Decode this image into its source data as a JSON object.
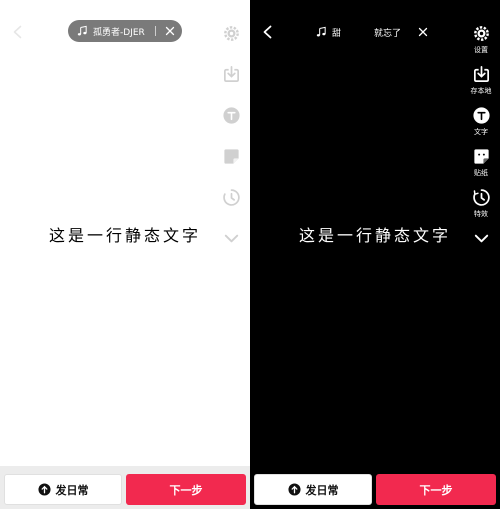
{
  "colors": {
    "accent": "#f2294f",
    "pill_bg": "#7a7a7a",
    "dark_bg": "#000000",
    "light_bg": "#ffffff"
  },
  "left_screen": {
    "music": {
      "icon": "music-note-icon",
      "title": "孤勇者-DJER"
    },
    "caption": "这是一行静态文字",
    "toolbar": [
      {
        "icon": "gear-icon"
      },
      {
        "icon": "download-icon"
      },
      {
        "icon": "text-icon"
      },
      {
        "icon": "sticker-icon"
      },
      {
        "icon": "effects-icon"
      },
      {
        "icon": "chevron-down-icon"
      }
    ],
    "bottom": {
      "publish_label": "发日常",
      "next_label": "下一步"
    }
  },
  "right_screen": {
    "music": {
      "icon": "music-note-icon",
      "title": "甜",
      "title_part2": "就忘了"
    },
    "caption": "这是一行静态文字",
    "toolbar": [
      {
        "icon": "gear-icon",
        "label": "设置"
      },
      {
        "icon": "download-icon",
        "label": "存本地"
      },
      {
        "icon": "text-icon",
        "label": "文字"
      },
      {
        "icon": "sticker-icon",
        "label": "贴纸"
      },
      {
        "icon": "effects-icon",
        "label": "特效"
      },
      {
        "icon": "chevron-down-icon"
      }
    ],
    "bottom": {
      "publish_label": "发日常",
      "next_label": "下一步"
    }
  }
}
